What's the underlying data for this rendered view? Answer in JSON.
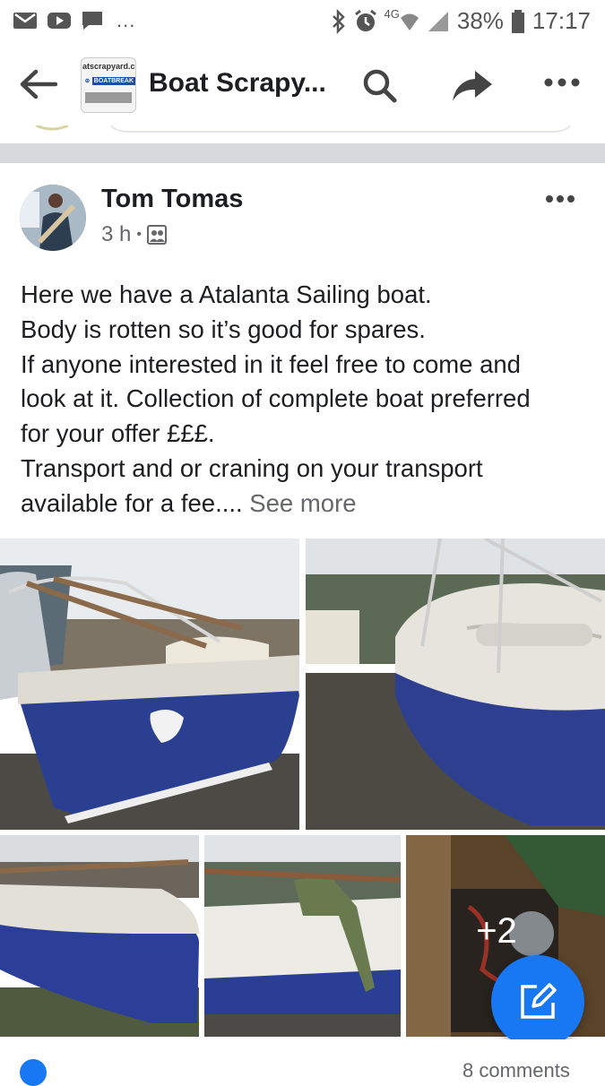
{
  "status_bar": {
    "overflow_dots": "...",
    "network": "4G",
    "battery": "38%",
    "time": "17:17",
    "icons": [
      "gmail-icon",
      "youtube-icon",
      "message-icon",
      "bluetooth-icon",
      "alarm-icon",
      "wifi-icon",
      "signal-icon",
      "battery-icon"
    ]
  },
  "app_bar": {
    "title": "Boat Scrapy...",
    "logo_line1": "atscrapyard.c",
    "logo_line2": "BOATBREAK"
  },
  "post": {
    "author": "Tom Tomas",
    "time": "3 h",
    "dot": "•",
    "lines": [
      "Here we have a Atalanta Sailing boat.",
      "Body is rotten so it’s good for spares.",
      "If anyone interested in it feel free to come and",
      "look at it. Collection of complete boat preferred",
      "for your offer £££.",
      "Transport and or craning on your transport",
      "available for a fee...."
    ],
    "see_more": "See more",
    "more_photos": "+2",
    "comments": "8 comments"
  },
  "colors": {
    "accent": "#1877f2",
    "text": "#1c1e21",
    "secondary": "#65676b",
    "divider": "#d7d9dc"
  }
}
